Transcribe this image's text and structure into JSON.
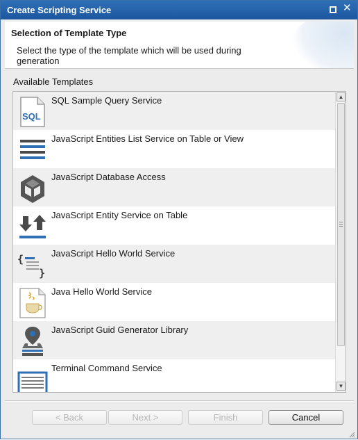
{
  "window": {
    "title": "Create Scripting Service"
  },
  "header": {
    "title": "Selection of Template Type",
    "description": "Select the type of the template which will be used during generation"
  },
  "templates": {
    "label": "Available Templates",
    "items": [
      {
        "label": "SQL Sample Query Service",
        "icon": "sql-file-icon"
      },
      {
        "label": "JavaScript Entities List Service on Table or View",
        "icon": "list-icon"
      },
      {
        "label": "JavaScript Database Access",
        "icon": "database-cube-icon"
      },
      {
        "label": "JavaScript Entity Service on Table",
        "icon": "transfer-arrows-icon"
      },
      {
        "label": "JavaScript Hello World Service",
        "icon": "braces-document-icon"
      },
      {
        "label": "Java Hello World Service",
        "icon": "java-cup-icon"
      },
      {
        "label": "JavaScript Guid Generator Library",
        "icon": "location-pin-icon"
      },
      {
        "label": "Terminal Command Service",
        "icon": "terminal-icon"
      }
    ]
  },
  "buttons": {
    "back": "< Back",
    "next": "Next >",
    "finish": "Finish",
    "cancel": "Cancel"
  },
  "colors": {
    "titlebar": "#1c57a0",
    "icon_blue": "#2f6fb6",
    "icon_gray": "#555555"
  }
}
